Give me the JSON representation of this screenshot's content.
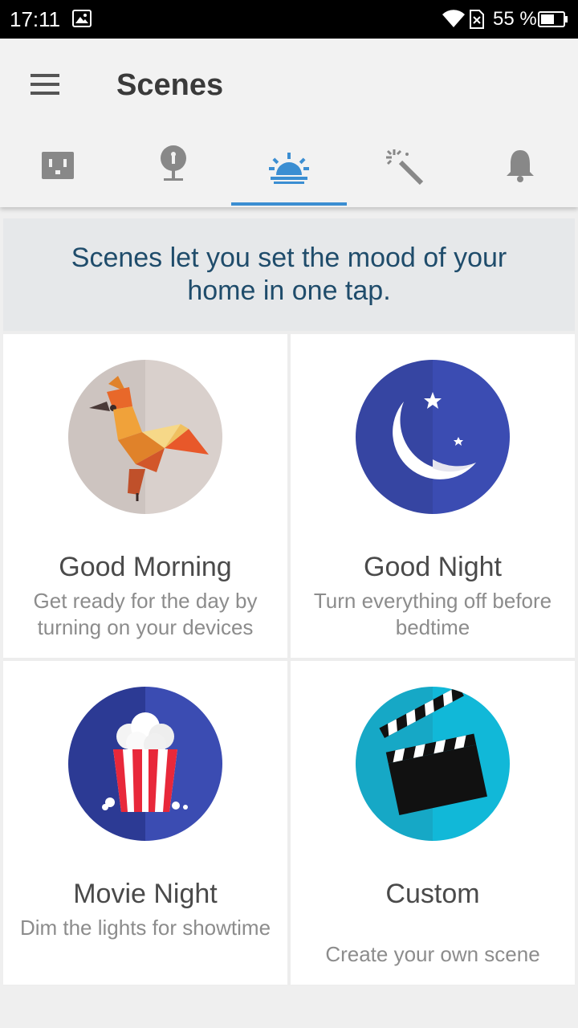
{
  "status_bar": {
    "time": "17:11",
    "battery": "55 %"
  },
  "app_bar": {
    "title": "Scenes"
  },
  "tabs": [
    {
      "name": "outlet",
      "icon": "outlet-icon",
      "active": false
    },
    {
      "name": "bulb",
      "icon": "lightbulb-icon",
      "active": false
    },
    {
      "name": "scenes",
      "icon": "sunrise-icon",
      "active": true
    },
    {
      "name": "magic",
      "icon": "magic-wand-icon",
      "active": false
    },
    {
      "name": "alerts",
      "icon": "bell-icon",
      "active": false
    }
  ],
  "banner": {
    "text": "Scenes let you set the mood of your home in one tap."
  },
  "scenes": [
    {
      "title": "Good Morning",
      "description": "Get ready for the day by turning on your devices",
      "icon": "rooster-icon"
    },
    {
      "title": "Good Night",
      "description": "Turn everything off before bedtime",
      "icon": "moon-icon"
    },
    {
      "title": "Movie Night",
      "description": "Dim the lights for showtime",
      "icon": "popcorn-icon"
    },
    {
      "title": "Custom",
      "description": "Create your own scene",
      "icon": "clapperboard-icon"
    }
  ],
  "colors": {
    "accent": "#3b8ed2",
    "banner_text": "#1f4c6b",
    "night": "#3a4ab0",
    "custom": "#11b4d4"
  }
}
